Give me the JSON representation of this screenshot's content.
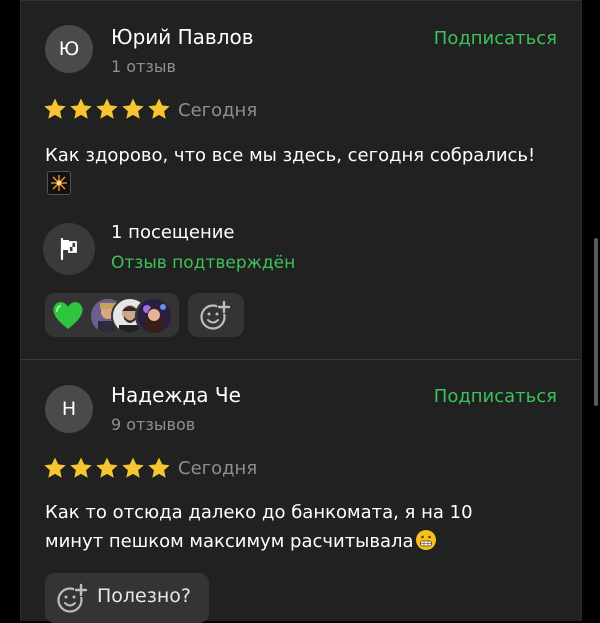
{
  "reviews": [
    {
      "initial": "Ю",
      "name": "Юрий Павлов",
      "count": "1 отзыв",
      "subscribe": "Подписаться",
      "rating": 5,
      "date": "Сегодня",
      "text": "Как здорово, что все мы здесь, сегодня собрались!",
      "visits": "1 посещение",
      "verified": "Отзыв подтверждён"
    },
    {
      "initial": "Н",
      "name": "Надежда Че",
      "count": "9 отзывов",
      "subscribe": "Подписаться",
      "rating": 5,
      "date": "Сегодня",
      "text": "Как то отсюда далеко до банкомата, я на 10 минут пешком максимум расчитывала",
      "useful": "Полезно?"
    }
  ],
  "colors": {
    "accent_green": "#3cc25a",
    "star_yellow": "#f7c531",
    "card_bg": "#212121",
    "muted_text": "#8f8f8f"
  }
}
